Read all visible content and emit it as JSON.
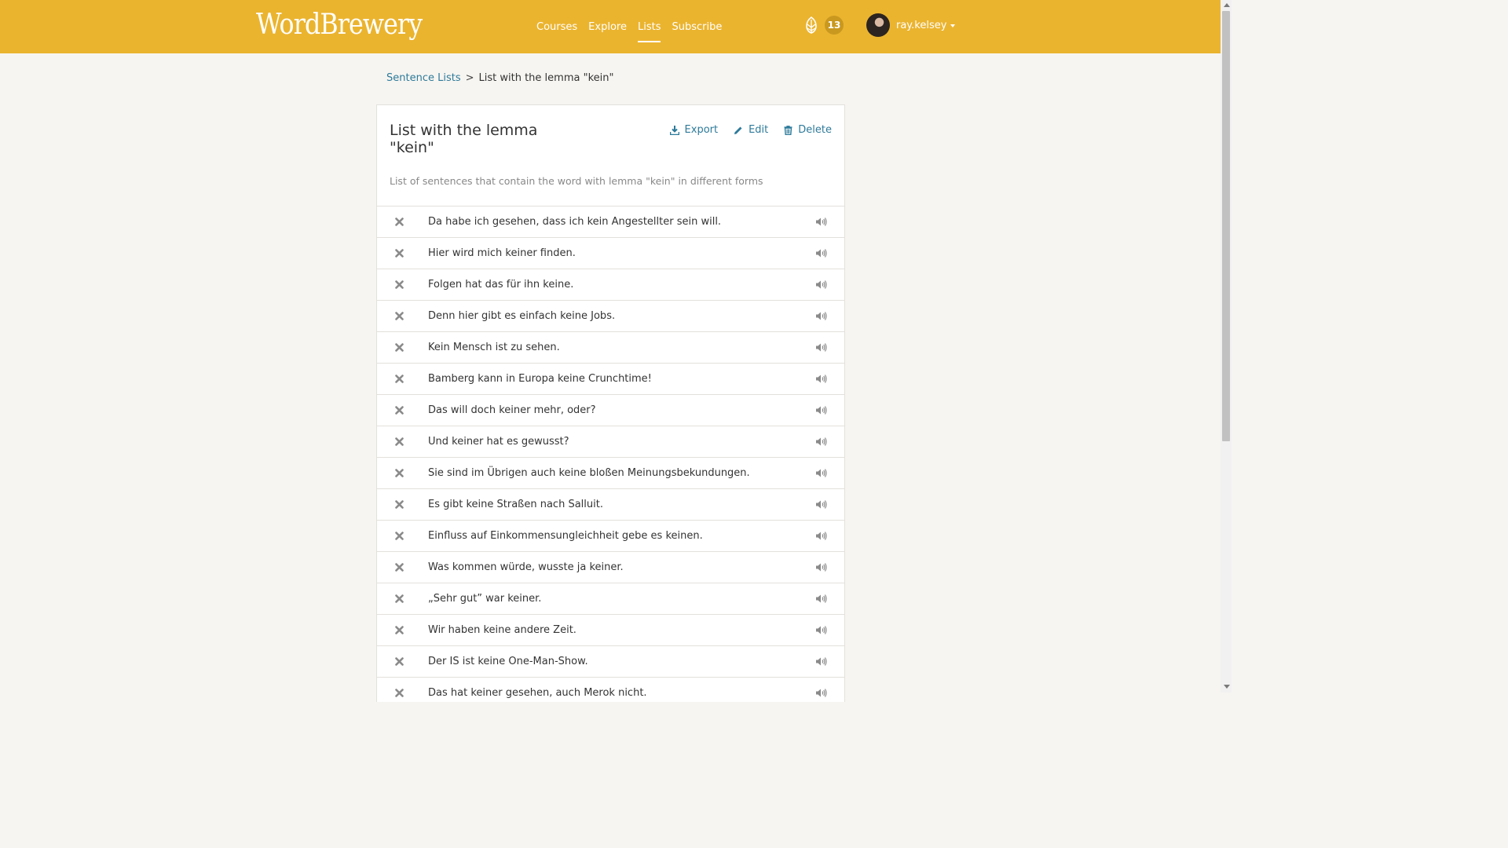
{
  "header": {
    "logo": "WordBrewery",
    "nav": [
      {
        "label": "Courses",
        "active": false
      },
      {
        "label": "Explore",
        "active": false
      },
      {
        "label": "Lists",
        "active": true
      },
      {
        "label": "Subscribe",
        "active": false
      }
    ],
    "hops_icon": "hops-icon",
    "hops_count": "13",
    "username": "ray.kelsey"
  },
  "breadcrumb": {
    "parent": "Sentence Lists",
    "separator": ">",
    "current": "List with the lemma \"kein\""
  },
  "list": {
    "title": "List with the lemma \"kein\"",
    "description": "List of sentences that contain the word with lemma \"kein\" in different forms",
    "actions": {
      "export": "Export",
      "edit": "Edit",
      "delete": "Delete"
    },
    "sentences": [
      "Da habe ich gesehen, dass ich kein Angestellter sein will.",
      "Hier wird mich keiner finden.",
      "Folgen hat das für ihn keine.",
      "Denn hier gibt es einfach keine Jobs.",
      "Kein Mensch ist zu sehen.",
      "Bamberg kann in Europa keine Crunchtime!",
      "Das will doch keiner mehr, oder?",
      "Und keiner hat es gewusst?",
      "Sie sind im Übrigen auch keine bloßen Meinungsbekundungen.",
      "Es gibt keine Straßen nach Salluit.",
      "Einfluss auf Einkommensungleichheit gebe es keinen.",
      "Was kommen würde, wusste ja keiner.",
      "„Sehr gut” war keiner.",
      "Wir haben keine andere Zeit.",
      "Der IS ist keine One-Man-Show.",
      "Das hat keiner gesehen, auch Merok nicht."
    ]
  },
  "colors": {
    "header_bg": "#ebb42f",
    "link": "#2d7a9a",
    "page_bg": "#f7f5f1"
  }
}
